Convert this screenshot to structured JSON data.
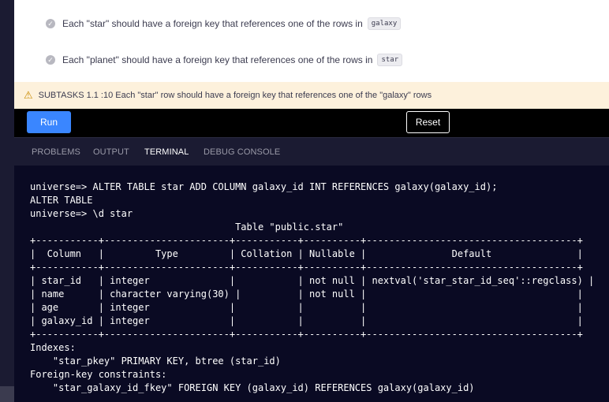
{
  "tasks": [
    {
      "text": "Each \"star\" should have a foreign key that references one of the rows in",
      "code": "galaxy"
    },
    {
      "text": "Each \"planet\" should have a foreign key that references one of the rows in",
      "code": "star"
    }
  ],
  "warning": {
    "text": "SUBTASKS 1.1 :10 Each \"star\" row should have a foreign key that references one of the \"galaxy\" rows"
  },
  "toolbar": {
    "run_label": "Run",
    "reset_label": "Reset"
  },
  "panel_tabs": [
    "PROBLEMS",
    "OUTPUT",
    "TERMINAL",
    "DEBUG CONSOLE"
  ],
  "active_tab": "TERMINAL",
  "terminal": {
    "lines": [
      "universe=> ALTER TABLE star ADD COLUMN galaxy_id INT REFERENCES galaxy(galaxy_id);",
      "ALTER TABLE",
      "universe=> \\d star",
      "                                    Table \"public.star\"",
      "+-----------+----------------------+-----------+----------+-------------------------------------+",
      "|  Column   |         Type         | Collation | Nullable |               Default               |",
      "+-----------+----------------------+-----------+----------+-------------------------------------+",
      "| star_id   | integer              |           | not null | nextval('star_star_id_seq'::regclass) |",
      "| name      | character varying(30) |          | not null |                                     |",
      "| age       | integer              |           |          |                                     |",
      "| galaxy_id | integer              |           |          |                                     |",
      "+-----------+----------------------+-----------+----------+-------------------------------------+",
      "Indexes:",
      "    \"star_pkey\" PRIMARY KEY, btree (star_id)",
      "Foreign-key constraints:",
      "    \"star_galaxy_id_fkey\" FOREIGN KEY (galaxy_id) REFERENCES galaxy(galaxy_id)"
    ]
  }
}
